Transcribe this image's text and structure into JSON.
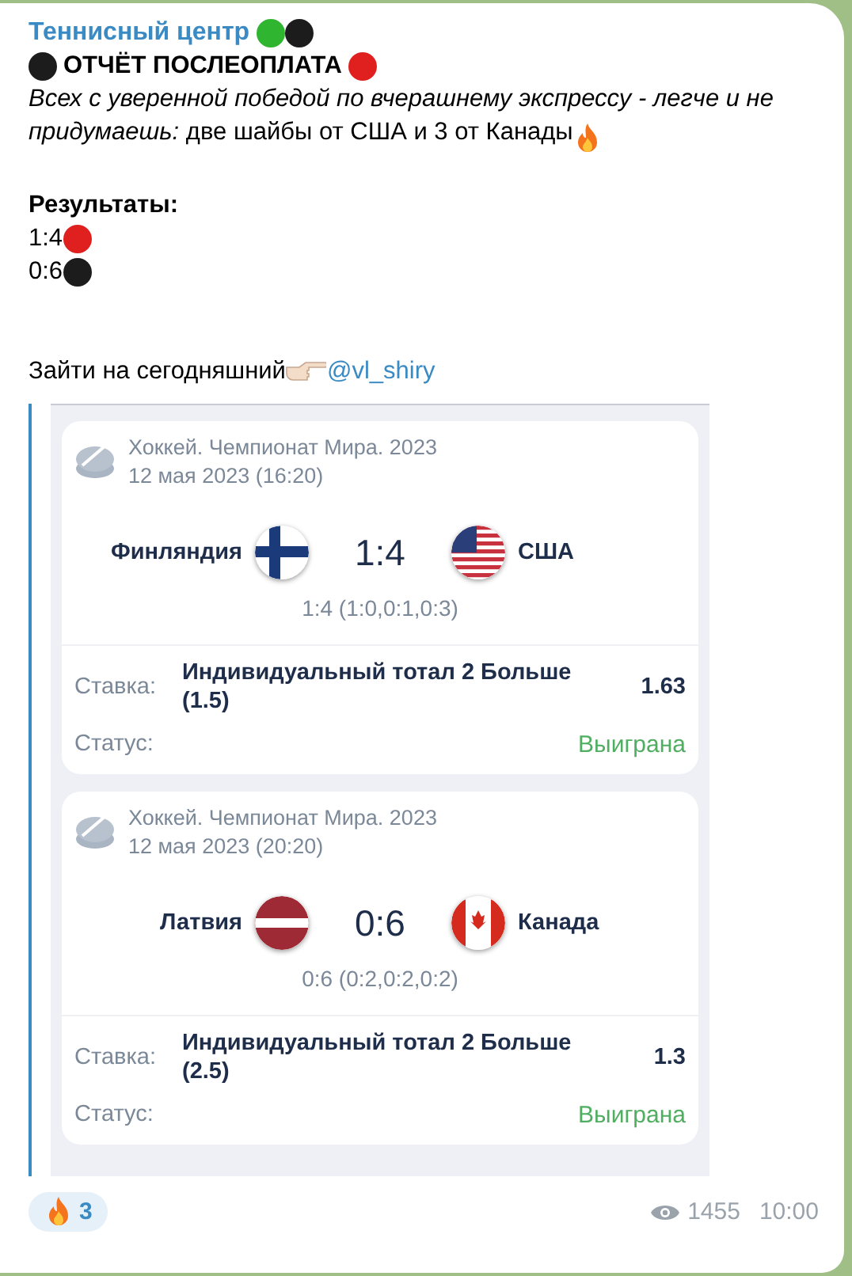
{
  "channel": {
    "name": "Теннисный центр",
    "dots": [
      {
        "color": "#2fb52f"
      },
      {
        "color": "#1c1c1c"
      }
    ]
  },
  "headline": {
    "lead_dot": {
      "color": "#1c1c1c"
    },
    "text": "ОТЧЁТ ПОСЛЕОПЛАТА",
    "trail_dot": {
      "color": "#e0201f"
    }
  },
  "intro": "*Всех с уверенной победой по вчерашнему экспрессу - легче и не придумаешь:* две шайбы от США и 3 от Канады",
  "results_title": "Результаты:",
  "results": [
    {
      "score": "1:4",
      "color": "#e0201f"
    },
    {
      "score": "0:6",
      "color": "#1c1c1c"
    }
  ],
  "cta": {
    "text": "Зайти на сегодняшний",
    "link": "@vl_shiry"
  },
  "bets": [
    {
      "tournament": "Хоккей. Чемпионат Мира. 2023",
      "date": "12 мая 2023 (16:20)",
      "home": {
        "name": "Финляндия",
        "kind": "fi"
      },
      "score": "1:4",
      "away": {
        "name": "США",
        "kind": "us"
      },
      "periods": "1:4 (1:0,0:1,0:3)",
      "bet_label": "Ставка:",
      "bet": "Индивидуальный тотал 2 Больше (1.5)",
      "odds": "1.63",
      "status_label": "Статус:",
      "status": "Выиграна"
    },
    {
      "tournament": "Хоккей. Чемпионат Мира. 2023",
      "date": "12 мая 2023 (20:20)",
      "home": {
        "name": "Латвия",
        "kind": "lv"
      },
      "score": "0:6",
      "away": {
        "name": "Канада",
        "kind": "ca"
      },
      "periods": "0:6 (0:2,0:2,0:2)",
      "bet_label": "Ставка:",
      "bet": "Индивидуальный тотал 2 Больше (2.5)",
      "odds": "1.3",
      "status_label": "Статус:",
      "status": "Выиграна"
    }
  ],
  "reaction": {
    "count": "3"
  },
  "views": "1455",
  "time": "10:00"
}
